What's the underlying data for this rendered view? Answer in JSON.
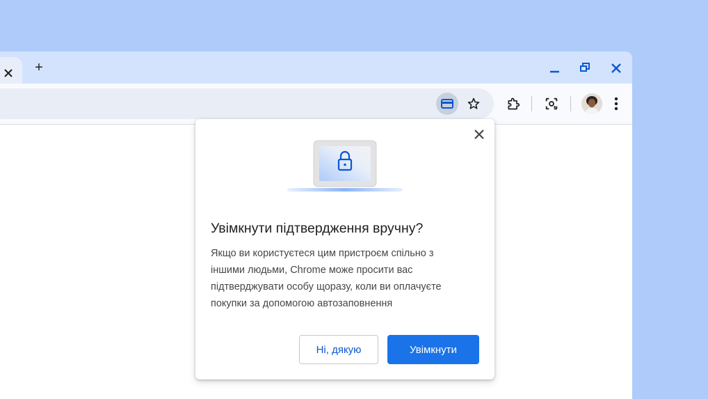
{
  "tabstrip": {
    "tab_close_icon": "close-icon",
    "new_tab_label": "+",
    "window_controls": [
      "minimize-icon",
      "restore-icon",
      "close-icon"
    ]
  },
  "toolbar": {
    "icons": [
      "credit-card-icon",
      "star-icon",
      "extensions-icon",
      "lens-icon",
      "avatar",
      "more-vert-icon"
    ]
  },
  "dialog": {
    "title": "Увімкнути підтвердження вручну?",
    "body": "Якщо ви користуєтеся цим пристроєм спільно з іншими людьми, Chrome може просити вас підтверджувати особу щоразу, коли ви оплачуєте покупки за допомогою автозаповнення",
    "secondary_button": "Ні, дякую",
    "primary_button": "Увімкнути"
  },
  "colors": {
    "background": "#aecbfa",
    "tabstrip": "#d3e3fd",
    "accent": "#1a73e8",
    "window_control": "#0b57d0"
  }
}
